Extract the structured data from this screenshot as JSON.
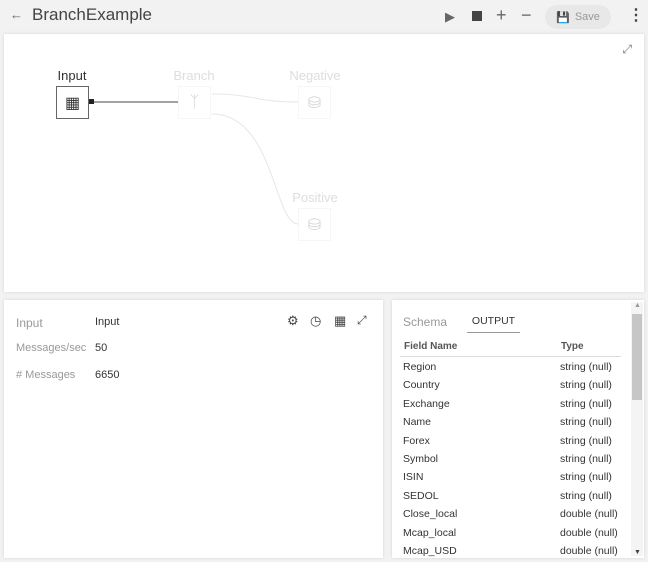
{
  "header": {
    "title": "BranchExample",
    "save_label": "Save"
  },
  "canvas": {
    "nodes": [
      {
        "label": "Input"
      },
      {
        "label": "Branch"
      },
      {
        "label": "Negative"
      },
      {
        "label": "Positive"
      }
    ]
  },
  "details": {
    "rows": [
      {
        "label": "Input",
        "value": "Input"
      },
      {
        "label": "Messages/sec",
        "value": "50"
      },
      {
        "label": "# Messages",
        "value": "6650"
      }
    ]
  },
  "schema": {
    "tab_schema": "Schema",
    "tab_output": "OUTPUT",
    "col_field": "Field Name",
    "col_type": "Type",
    "fields": [
      {
        "name": "Region",
        "type": "string (null)"
      },
      {
        "name": "Country",
        "type": "string (null)"
      },
      {
        "name": "Exchange",
        "type": "string (null)"
      },
      {
        "name": "Name",
        "type": "string (null)"
      },
      {
        "name": "Forex",
        "type": "string (null)"
      },
      {
        "name": "Symbol",
        "type": "string (null)"
      },
      {
        "name": "ISIN",
        "type": "string (null)"
      },
      {
        "name": "SEDOL",
        "type": "string (null)"
      },
      {
        "name": "Close_local",
        "type": "double (null)"
      },
      {
        "name": "Mcap_local",
        "type": "double (null)"
      },
      {
        "name": "Mcap_USD",
        "type": "double (null)"
      }
    ]
  }
}
